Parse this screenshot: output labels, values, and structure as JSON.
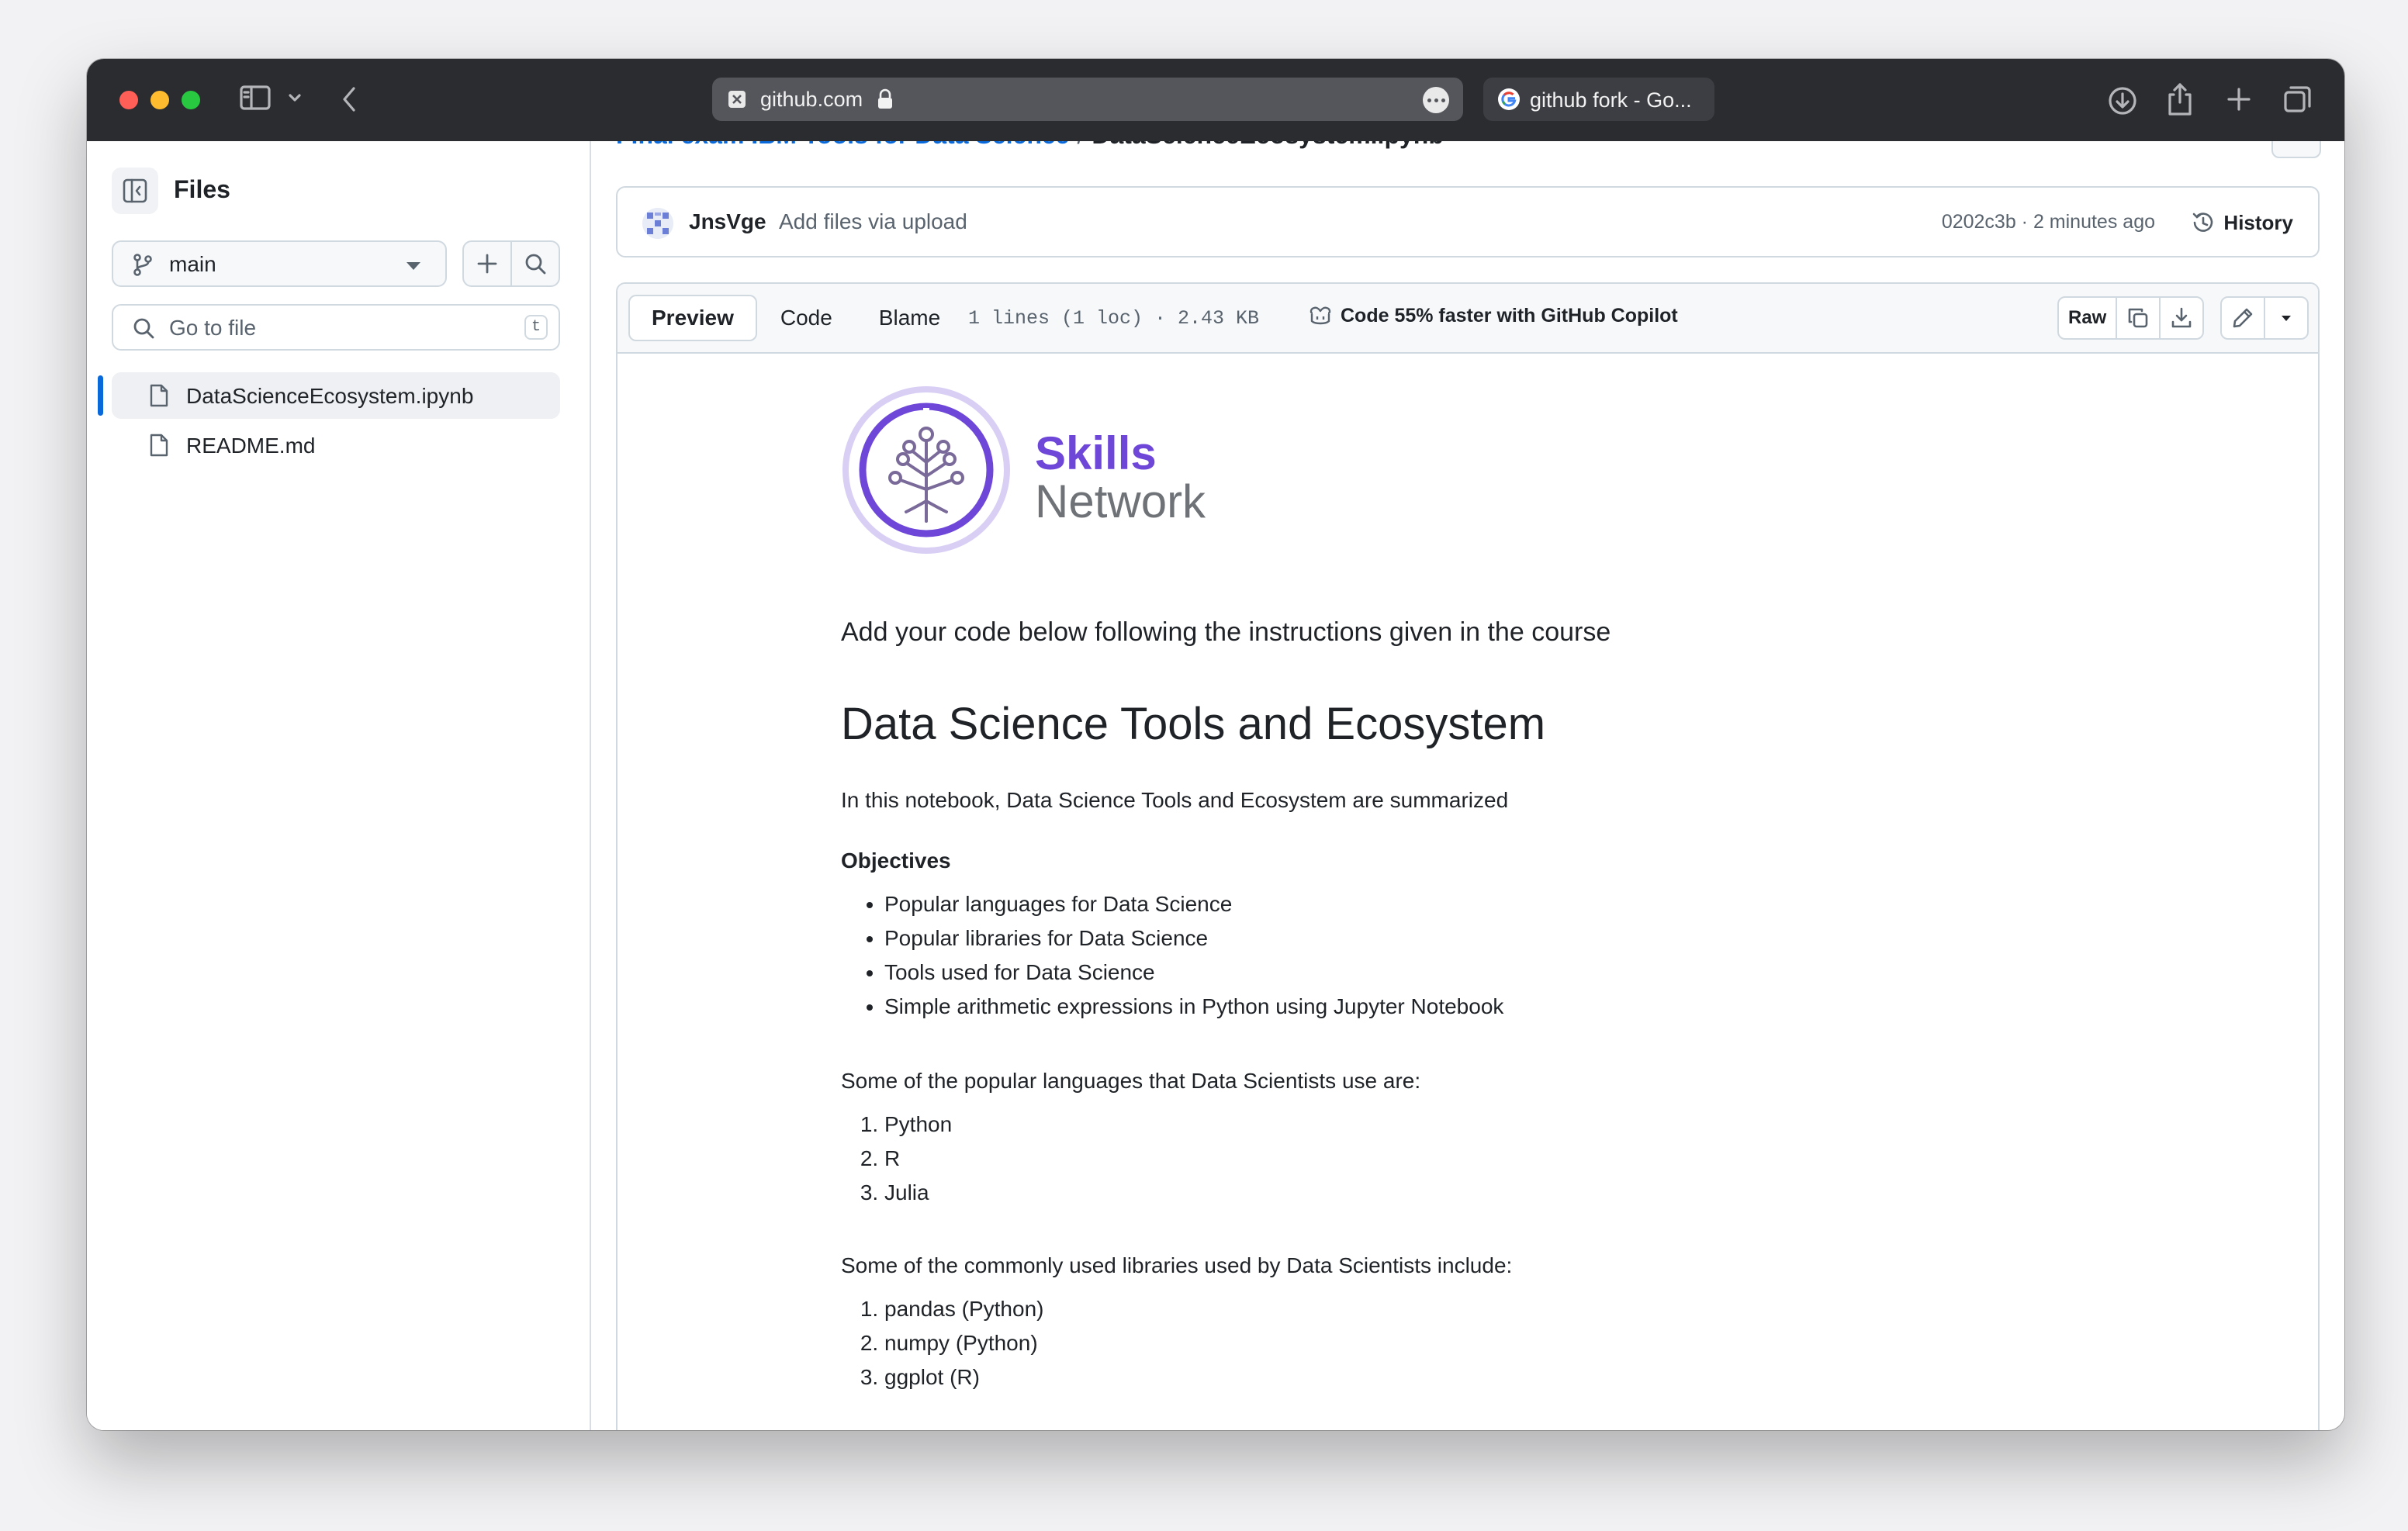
{
  "browser": {
    "url": "github.com",
    "second_tab": "github fork - Go..."
  },
  "sidebar": {
    "title": "Files",
    "branch": "main",
    "goto_placeholder": "Go to file",
    "goto_shortcut": "t",
    "files": [
      {
        "label": "DataScienceEcosystem.ipynb",
        "active": true
      },
      {
        "label": "README.md",
        "active": false
      }
    ]
  },
  "breadcrumb": {
    "repo": "Final exam IBM Tools for Data Science",
    "separator": "/",
    "file": "DataScienceEcosystem.ipynb"
  },
  "commit": {
    "author": "JnsVge",
    "message": "Add files via upload",
    "sha_time": "0202c3b · 2 minutes ago",
    "history_label": "History"
  },
  "file_header": {
    "tabs": [
      "Preview",
      "Code",
      "Blame"
    ],
    "active_tab": "Preview",
    "meta": "1 lines (1 loc) · 2.43 KB",
    "copilot": "Code 55% faster with GitHub Copilot",
    "raw_label": "Raw"
  },
  "notebook": {
    "logo_line1": "Skills",
    "logo_line2": "Network",
    "intro": "Add your code below following the instructions given in the course",
    "title": "Data Science Tools and Ecosystem",
    "summary": "In this notebook, Data Science Tools and Ecosystem are summarized",
    "objectives_heading": "Objectives",
    "objectives": [
      "Popular languages for Data Science",
      "Popular libraries for Data Science",
      "Tools used for Data Science",
      "Simple arithmetic expressions in Python using Jupyter Notebook"
    ],
    "languages_intro": "Some of the popular languages that Data Scientists use are:",
    "languages": [
      "Python",
      "R",
      "Julia"
    ],
    "libraries_intro": "Some of the commonly used libraries used by Data Scientists include:",
    "libraries": [
      "pandas (Python)",
      "numpy (Python)",
      "ggplot (R)"
    ]
  },
  "colors": {
    "accent": "#0969da",
    "skills_purple": "#6e47d8",
    "chrome": "#2b2c30"
  }
}
